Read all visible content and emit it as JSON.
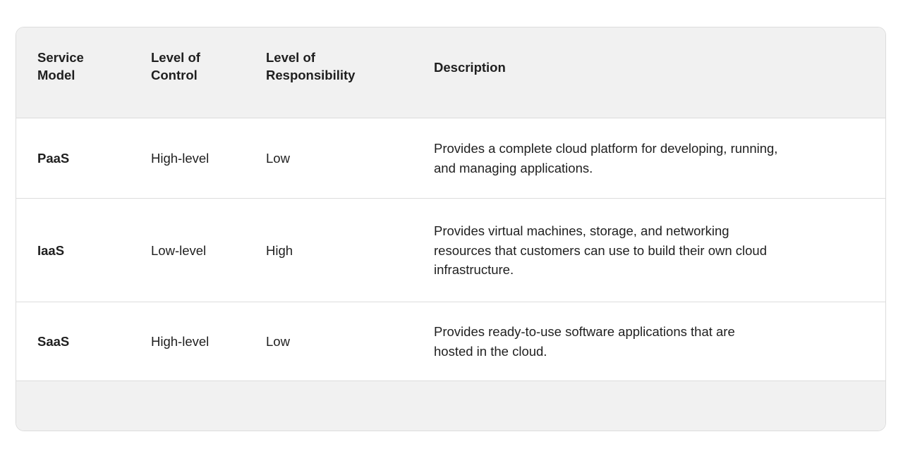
{
  "table": {
    "columns": [
      {
        "id": "service_model",
        "label": "Service\nModel",
        "label_line1": "Service",
        "label_line2": "Model"
      },
      {
        "id": "level_of_control",
        "label": "Level of\nControl",
        "label_line1": "Level of",
        "label_line2": "Control"
      },
      {
        "id": "level_of_responsibility",
        "label": "Level of\nResponsibility",
        "label_line1": "Level of",
        "label_line2": "Responsibility"
      },
      {
        "id": "description",
        "label": "Description",
        "label_line1": "Description",
        "label_line2": ""
      }
    ],
    "rows": [
      {
        "service_model": "PaaS",
        "level_of_control": "High-level",
        "level_of_responsibility": "Low",
        "description": "Provides a complete cloud platform for developing, running, and managing applications.",
        "description_lines": [
          "Provides a complete cloud platform for developing, running,",
          "and managing applications."
        ]
      },
      {
        "service_model": "IaaS",
        "level_of_control": "Low-level",
        "level_of_responsibility": "High",
        "description": "Provides virtual machines, storage, and networking resources that customers can use to build their own cloud infrastructure.",
        "description_lines": [
          "Provides virtual machines, storage, and networking",
          "resources that customers can use to build their own cloud",
          "infrastructure."
        ]
      },
      {
        "service_model": "SaaS",
        "level_of_control": "High-level",
        "level_of_responsibility": "Low",
        "description": "Provides ready-to-use software applications that are hosted in the cloud.",
        "description_lines": [
          "Provides ready-to-use software applications that are",
          "hosted in the cloud."
        ]
      }
    ],
    "footer": {
      "text": ""
    }
  },
  "colors": {
    "page_background": "#ffffff",
    "card_border": "#dcdcdc",
    "header_background": "#f1f1f1",
    "footer_background": "#f1f1f1",
    "row_background": "#ffffff",
    "text": "#1f1f1f",
    "divider": "#dcdcdc"
  }
}
